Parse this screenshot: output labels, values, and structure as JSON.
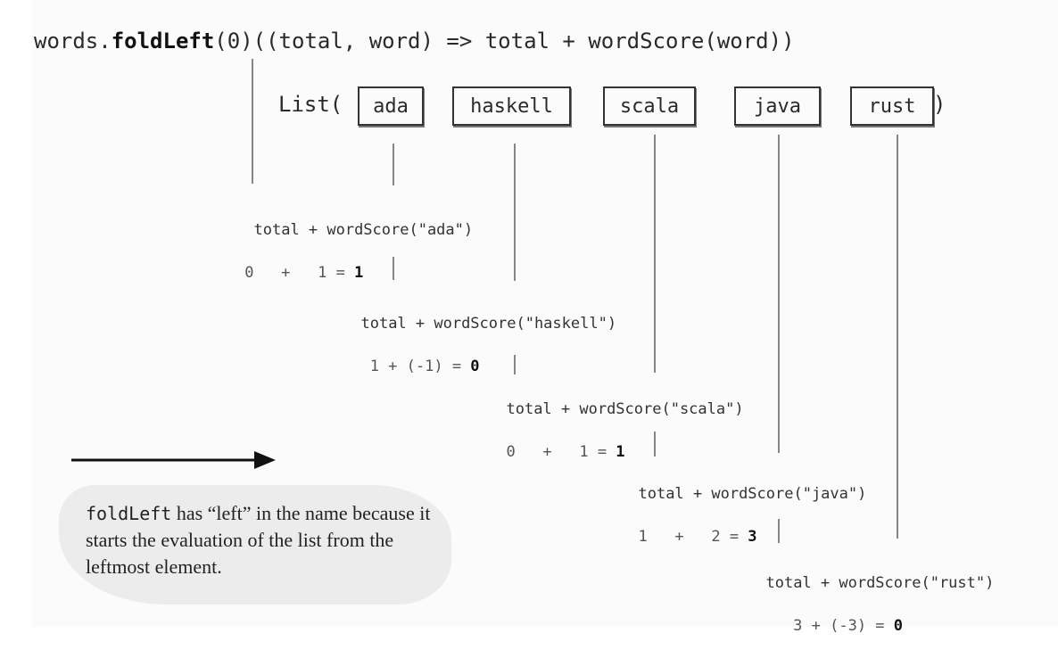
{
  "code": {
    "prefix": "words.",
    "method": "foldLeft",
    "suffix": "(0)((total, word) => total + wordScore(word))"
  },
  "list": {
    "open": "List(",
    "close": ")",
    "words": [
      "ada",
      "haskell",
      "scala",
      "java",
      "rust"
    ]
  },
  "steps": [
    {
      "expr": "total + wordScore(\"ada\")",
      "calc_pre": " 0   +   1 = ",
      "result": "1"
    },
    {
      "expr": "total + wordScore(\"haskell\")",
      "calc_pre": "   1 + (-1) = ",
      "result": "0"
    },
    {
      "expr": "total + wordScore(\"scala\")",
      "calc_pre": "  0   +   1 = ",
      "result": "1"
    },
    {
      "expr": "total + wordScore(\"java\")",
      "calc_pre": "  1   +   2 = ",
      "result": "3"
    },
    {
      "expr": "total + wordScore(\"rust\")",
      "calc_pre": "     3 + (-3) = ",
      "result": "0"
    }
  ],
  "note": {
    "code_word": "foldLeft",
    "text": " has “left” in the name because it starts the evaluation of the list from the leftmost element."
  }
}
